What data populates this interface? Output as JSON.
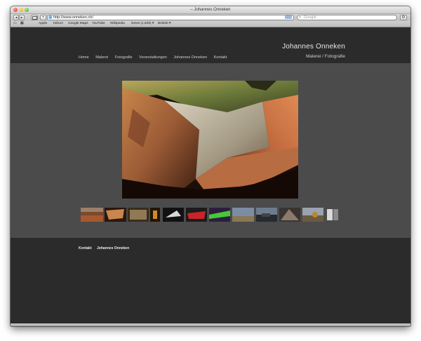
{
  "browser": {
    "window_title": "– Johannes Onneken",
    "url": "http://www.onneken.ch/",
    "search_placeholder": "Google",
    "back_glyph": "◀",
    "forward_glyph": "▶",
    "add_glyph": "+",
    "bookmarks": [
      "Apple",
      "Yahoo!",
      "Google Maps",
      "YouTube",
      "Wikipedia",
      "News (1,629) ▾",
      "Beliebt ▾"
    ]
  },
  "site": {
    "title": "Johannes Onneken",
    "subtitle": "Malerei / Fotografie",
    "nav": [
      "Home",
      "Malerei",
      "Fotografie",
      "Veranstaltungen",
      "Johannes Onneken",
      "Kontakt"
    ],
    "footer": [
      "Kontakt",
      "Johannes Onneken"
    ]
  },
  "gallery": {
    "thumbnail_count": 12
  }
}
